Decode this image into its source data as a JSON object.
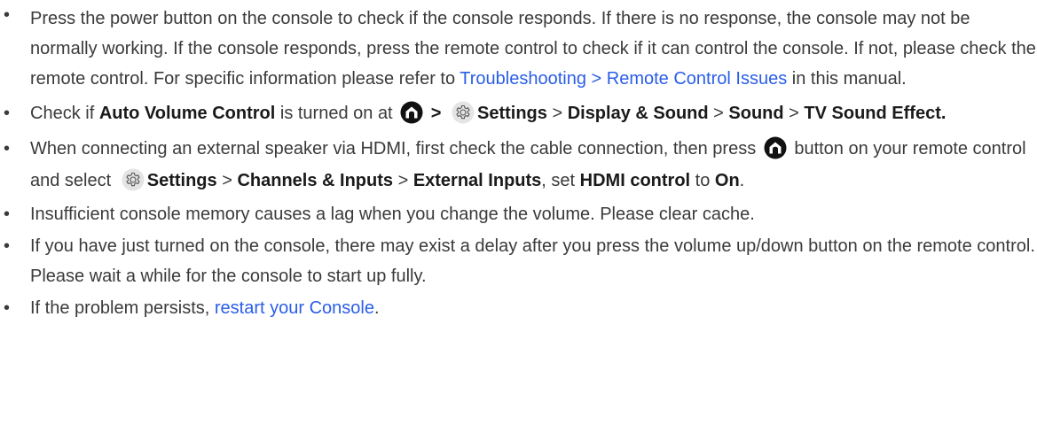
{
  "items": [
    {
      "t1": "Press the power button on the console to check if the console responds. If there is no response, the console may not be normally working. If the console responds, press the remote control to check if it can control the console. If not, please check the remote control. For specific information please refer to ",
      "link": "Troubleshooting > Remote Control Issues",
      "t2": " in this manual."
    },
    {
      "t1": "Check if ",
      "b1": "Auto Volume Control",
      "t2": " is turned on at ",
      "sep1": " > ",
      "b2": "Settings",
      "sep2": " > ",
      "b3": "Display & Sound",
      "sep3": " > ",
      "b4": "Sound",
      "sep4": " > ",
      "b5": "TV Sound Effect."
    },
    {
      "t1": "When connecting an external speaker via HDMI, first check the cable connection, then press ",
      "t2": " button on your remote control and select ",
      "b1": "Settings",
      "sep1": " > ",
      "b2": "Channels & Inputs",
      "sep2": " > ",
      "b3": "External Inputs",
      "t3": ", set ",
      "b4": "HDMI control",
      "t4": " to ",
      "b5": "On",
      "t5": "."
    },
    {
      "t1": "Insufficient console memory causes a lag when you change the volume. Please clear cache."
    },
    {
      "t1": "If you have just turned on the console, there may exist a delay after you press the volume up/down button on the remote control. Please wait a while for the console to start up fully."
    },
    {
      "t1": "If the problem persists, ",
      "link": "restart your Console",
      "t2": "."
    }
  ],
  "icons": {
    "home": "home-icon",
    "settings": "gear-icon"
  },
  "colors": {
    "link": "#2a5ee8",
    "text": "#3a3a3a",
    "icon": "#111111"
  }
}
